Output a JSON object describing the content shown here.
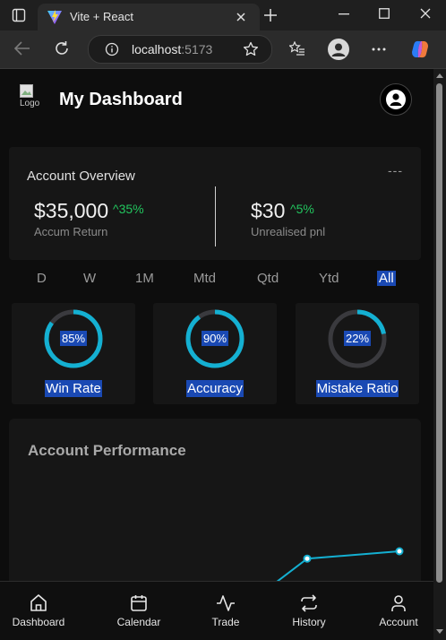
{
  "browser": {
    "tab_title": "Vite + React",
    "url_host": "localhost",
    "url_port": ":5173"
  },
  "header": {
    "logo_alt": "Logo",
    "title": "My Dashboard",
    "profile_icon": "user-icon"
  },
  "overview": {
    "title": "Account Overview",
    "menu": "---",
    "accum_value": "$35,000",
    "accum_change": "^35%",
    "accum_label": "Accum Return",
    "pnl_value": "$30",
    "pnl_change": "^5%",
    "pnl_label": "Unrealised pnl",
    "positive_color": "#22c55e"
  },
  "periods": [
    "D",
    "W",
    "1M",
    "Mtd",
    "Qtd",
    "Ytd",
    "All"
  ],
  "active_period": "All",
  "metrics": [
    {
      "label": "Win Rate",
      "value": "85%",
      "fraction": 0.85
    },
    {
      "label": "Accuracy",
      "value": "90%",
      "fraction": 0.9
    },
    {
      "label": "Mistake Ratio",
      "value": "22%",
      "fraction": 0.22
    }
  ],
  "performance": {
    "title": "Account Performance",
    "line_color": "#14b0d2",
    "points": [
      1,
      2,
      3,
      4,
      5
    ]
  },
  "nav": [
    {
      "label": "Dashboard",
      "icon": "home-icon"
    },
    {
      "label": "Calendar",
      "icon": "calendar-icon"
    },
    {
      "label": "Trade",
      "icon": "activity-icon"
    },
    {
      "label": "History",
      "icon": "repeat-icon"
    },
    {
      "label": "Account",
      "icon": "user-icon"
    }
  ],
  "colors": {
    "accent": "#14b0d2",
    "highlight": "#1a49b3",
    "background": "#0d0d0d",
    "card": "#161616"
  }
}
